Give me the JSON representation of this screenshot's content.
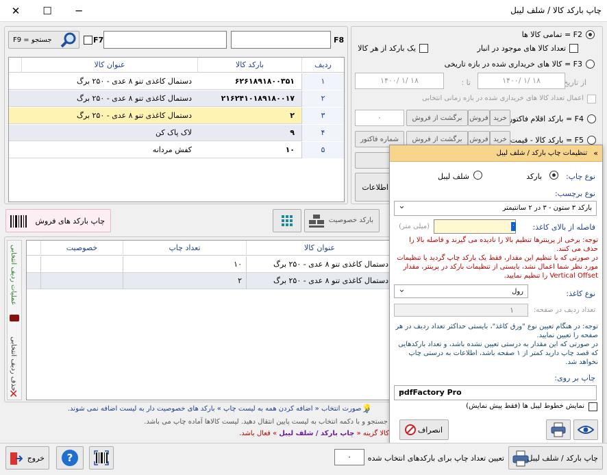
{
  "window": {
    "title": "چاپ بارکد کالا / شلف لیبل",
    "minimize": "─",
    "maximize": "☐",
    "close": "✕"
  },
  "search": {
    "f8_label": "F8",
    "f7_label": "F7",
    "button_label": "F9 = جستجو"
  },
  "grid": {
    "headers": [
      "ردیف",
      "بارکد کالا",
      "عنوان کالا"
    ],
    "rows": [
      {
        "num": "۱",
        "barcode": "۶۲۶۱۸۹۱۸۰۰۳۵۱",
        "title": "دستمال کاغذی تنو ۸ عدی - ۲۵۰ برگ",
        "state": "normal"
      },
      {
        "num": "۲",
        "barcode": "۲۱۶۲۴۱۰۱۸۹۱۸۰۰۱۷",
        "title": "دستمال کاغذی تنو ۸ عدی - ۲۵۰ برگ",
        "state": "alt"
      },
      {
        "num": "۳",
        "barcode": "۲",
        "title": "دستمال کاغذی تنو ۸ عدی - ۲۵۰ برگ",
        "state": "selected"
      },
      {
        "num": "۴",
        "barcode": "۹",
        "title": "لاک پاک کن",
        "state": "alt"
      },
      {
        "num": "۵",
        "barcode": "۱۰",
        "title": "کفش مردانه",
        "state": "normal"
      }
    ]
  },
  "filters": {
    "f2_all": "F2 = تمامی کالا ها",
    "stock_count": "تعداد کالا های موجود در انبار",
    "one_barcode": "یک بارکد از هر کالا",
    "f3_purchased": "F3 = کالا های خریداری شده در بازه تاریخی",
    "from_date_label": "از تاریخ :",
    "to_date_label": "تا :",
    "from_date": "۱۴۰۰/ ۱/ ۱۸",
    "to_date": "۱۴۰۰/ ۱/ ۱۸",
    "apply_count": "اعمال تعداد کالا های خریداری شده در بازه زمانی انتخابی",
    "f4_invoice": "F4 = بارکد اقلام فاکتور",
    "f5_price": "F5 = بارکد کالا - قیمت",
    "btn_buy": "خرید",
    "btn_sale": "فروش",
    "btn_return": "برگشت از فروش",
    "invoice_number": "شماره فاکتور",
    "zero_value": "۰",
    "info_btn": "اطلاعات"
  },
  "settings": {
    "header": "تنظیمات چاپ بارکد / شلف لیبل",
    "print_type_label": "نوع چاپ:",
    "opt_barcode": "بارکد",
    "opt_shelf": "شلف لیبل",
    "label_type_label": "نوع برچسب:",
    "label_type_value": "بارکد ۳ ستون - ۳ در ۲ سانتیمتر",
    "top_margin_label": "فاصله از بالای کاغذ:",
    "top_margin_unit": "(میلی متر)",
    "top_margin_value": "۰",
    "note1": "توجه: برخی از پرینترها تنظیم بالا را نادیده می گیرند و فاصله بالا را حذف می کنند.",
    "note1b": "در صورتی که با تنظیم این مقدار، فقط یک بارکد چاپ گردید یا تنظیمات مورد نظر شما اعمال نشد، بایستی از تنظیمات بارکد در پرینتر، مقدار Vertical Offset را تنظیم نمایید.",
    "paper_type_label": "نوع کاغذ:",
    "paper_type_value": "رول",
    "rows_per_page_label": "تعداد ردیف در صفحه:",
    "rows_per_page_value": "۱",
    "note2": "توجه: در هنگام تعیین نوع \"ورق کاغذ\"، بایستی حداکثر تعداد ردیف در هر صفحه را تعیین نمایید.",
    "note2b": "در صورتی که این مقدار به درستی تعیین نشده باشد، و تعداد بارکدهایی که قصد چاپ دارید کمتر از ۱ صفحه باشد، اطلاعات به درستی چاپ نخواهد شد.",
    "print_on_label": "چاپ بر روی:",
    "printer_value": "pdfFactory Pro",
    "show_lines": "نمایش خطوط لیبل ها (فقط پیش نمایش)",
    "cancel": "انصراف"
  },
  "toolbar": {
    "print_sales": "چاپ بارکد های فروش",
    "feature_barcode": "بارکد خصوصیت",
    "barcode_short": "بارکد"
  },
  "lower_grid": {
    "headers": [
      "عنوان کالا",
      "تعداد چاپ",
      "خصوصیت"
    ],
    "rows": [
      {
        "title": "دستمال کاغذی تنو ۸ عدی - ۲۵۰ برگ",
        "count": "۱۰",
        "feature": ""
      },
      {
        "title": "دستمال کاغذی تنو ۸ عدی - ۲۵۰ برگ",
        "count": "۲",
        "feature": ""
      }
    ]
  },
  "side": {
    "ops": "عملیات ردیف انتخابی",
    "del": "حذف ردیف انتخابی"
  },
  "hints": {
    "line1": "در صورت انتخاب « اضافه کردن همه به لیست چاپ » بارکد های خصوصیت دار به لیست اضافه نمی شوند.",
    "line2": "جستجو و با دکمه انتخاب به لیست پایین انتقال دهید. لیست کالاها آماده چاپ می باشد.",
    "line3_a": "کالا گزینه «",
    "line3_b": "چاپ بارکد / شلف لیبل",
    "line3_c": "» فعال باشد."
  },
  "bottom": {
    "exit": "خروج",
    "set_count": "تعیین تعداد چاپ برای بارکدهای انتخاب شده",
    "count_value": "۰",
    "print_main": "چاپ بارکد / شلف لیبل"
  }
}
